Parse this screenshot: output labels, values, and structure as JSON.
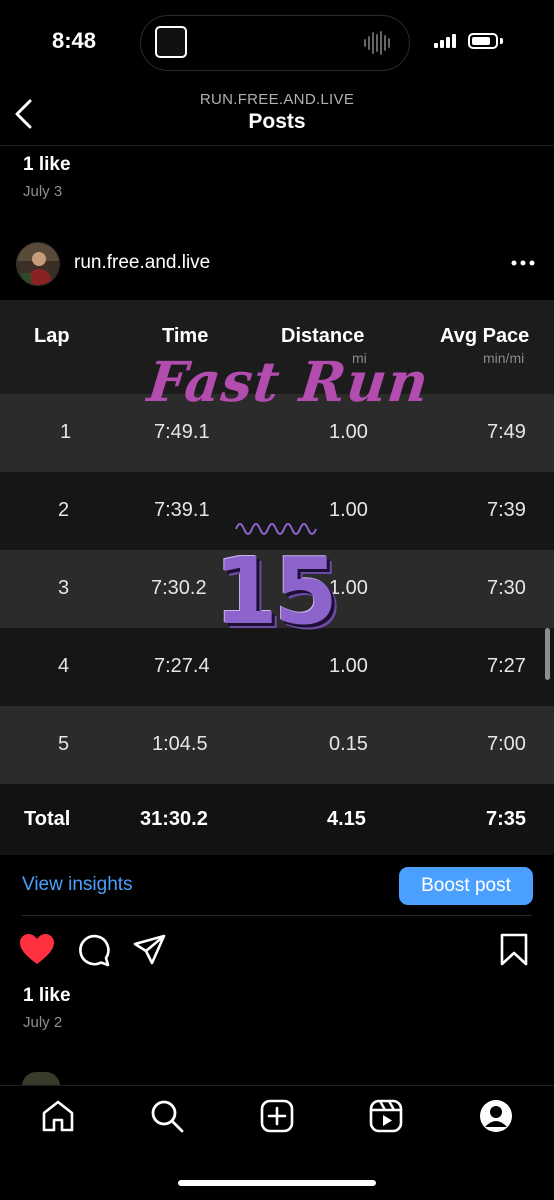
{
  "status": {
    "time": "8:48"
  },
  "nav": {
    "subtitle": "RUN.FREE.AND.LIVE",
    "title": "Posts"
  },
  "prev_post": {
    "likes": "1 like",
    "date": "July 3"
  },
  "post": {
    "username": "run.free.and.live",
    "table": {
      "headers": {
        "lap": "Lap",
        "time": "Time",
        "distance": "Distance",
        "distance_unit": "mi",
        "pace": "Avg Pace",
        "pace_unit": "min/mi"
      },
      "rows": [
        {
          "lap": "1",
          "time": "7:49.1",
          "distance": "1.00",
          "pace": "7:49"
        },
        {
          "lap": "2",
          "time": "7:39.1",
          "distance": "1.00",
          "pace": "7:39"
        },
        {
          "lap": "3",
          "time": "7:30.2",
          "distance": "1.00",
          "pace": "7:30"
        },
        {
          "lap": "4",
          "time": "7:27.4",
          "distance": "1.00",
          "pace": "7:27"
        },
        {
          "lap": "5",
          "time": "1:04.5",
          "distance": "0.15",
          "pace": "7:00"
        }
      ],
      "total": {
        "lap": "Total",
        "time": "31:30.2",
        "distance": "4.15",
        "pace": "7:35"
      }
    },
    "overlay": {
      "title": "Fast Run",
      "number": "15"
    },
    "insights_label": "View insights",
    "boost_label": "Boost post",
    "likes": "1 like",
    "date": "July 2"
  },
  "colors": {
    "accent": "#4ba0ff",
    "heart": "#ff3040",
    "overlay_pink": "#b24cae",
    "overlay_purple": "#8d63cc"
  },
  "icons": {
    "actions": [
      "heart-icon",
      "comment-icon",
      "share-icon",
      "bookmark-icon"
    ],
    "tabbar": [
      "home-icon",
      "search-icon",
      "create-icon",
      "reels-icon",
      "profile-icon"
    ]
  }
}
